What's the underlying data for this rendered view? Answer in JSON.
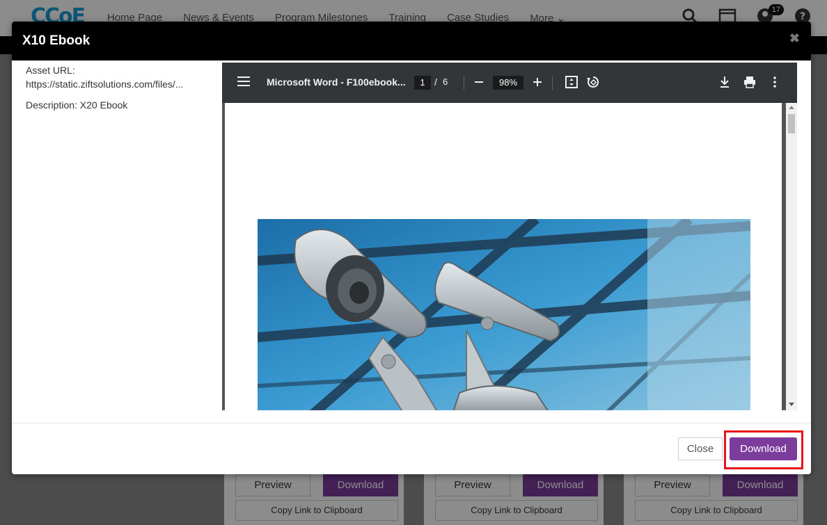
{
  "background": {
    "logo": "CCoE",
    "nav": [
      "Home Page",
      "News & Events",
      "Program Milestones",
      "Training",
      "Case Studies",
      "More"
    ],
    "notification_count": "17",
    "cards": [
      {
        "preview": "Preview",
        "download": "Download",
        "copy": "Copy Link to Clipboard"
      },
      {
        "preview": "Preview",
        "download": "Download",
        "copy": "Copy Link to Clipboard"
      },
      {
        "preview": "Preview",
        "download": "Download",
        "copy": "Copy Link to Clipboard"
      }
    ]
  },
  "modal": {
    "title": "X10 Ebook",
    "close_symbol": "✖",
    "asset_url_label": "Asset URL:",
    "asset_url": "https://static.ziftsolutions.com/files/...",
    "description": "Description: X20 Ebook"
  },
  "pdf_viewer": {
    "document_title": "Microsoft Word - F100ebook...",
    "current_page": "1",
    "page_separator": "/",
    "total_pages": "6",
    "zoom": "98%"
  },
  "footer": {
    "close_label": "Close",
    "download_label": "Download"
  },
  "colors": {
    "accent": "#7b3c9c",
    "highlight": "#e8141b"
  }
}
